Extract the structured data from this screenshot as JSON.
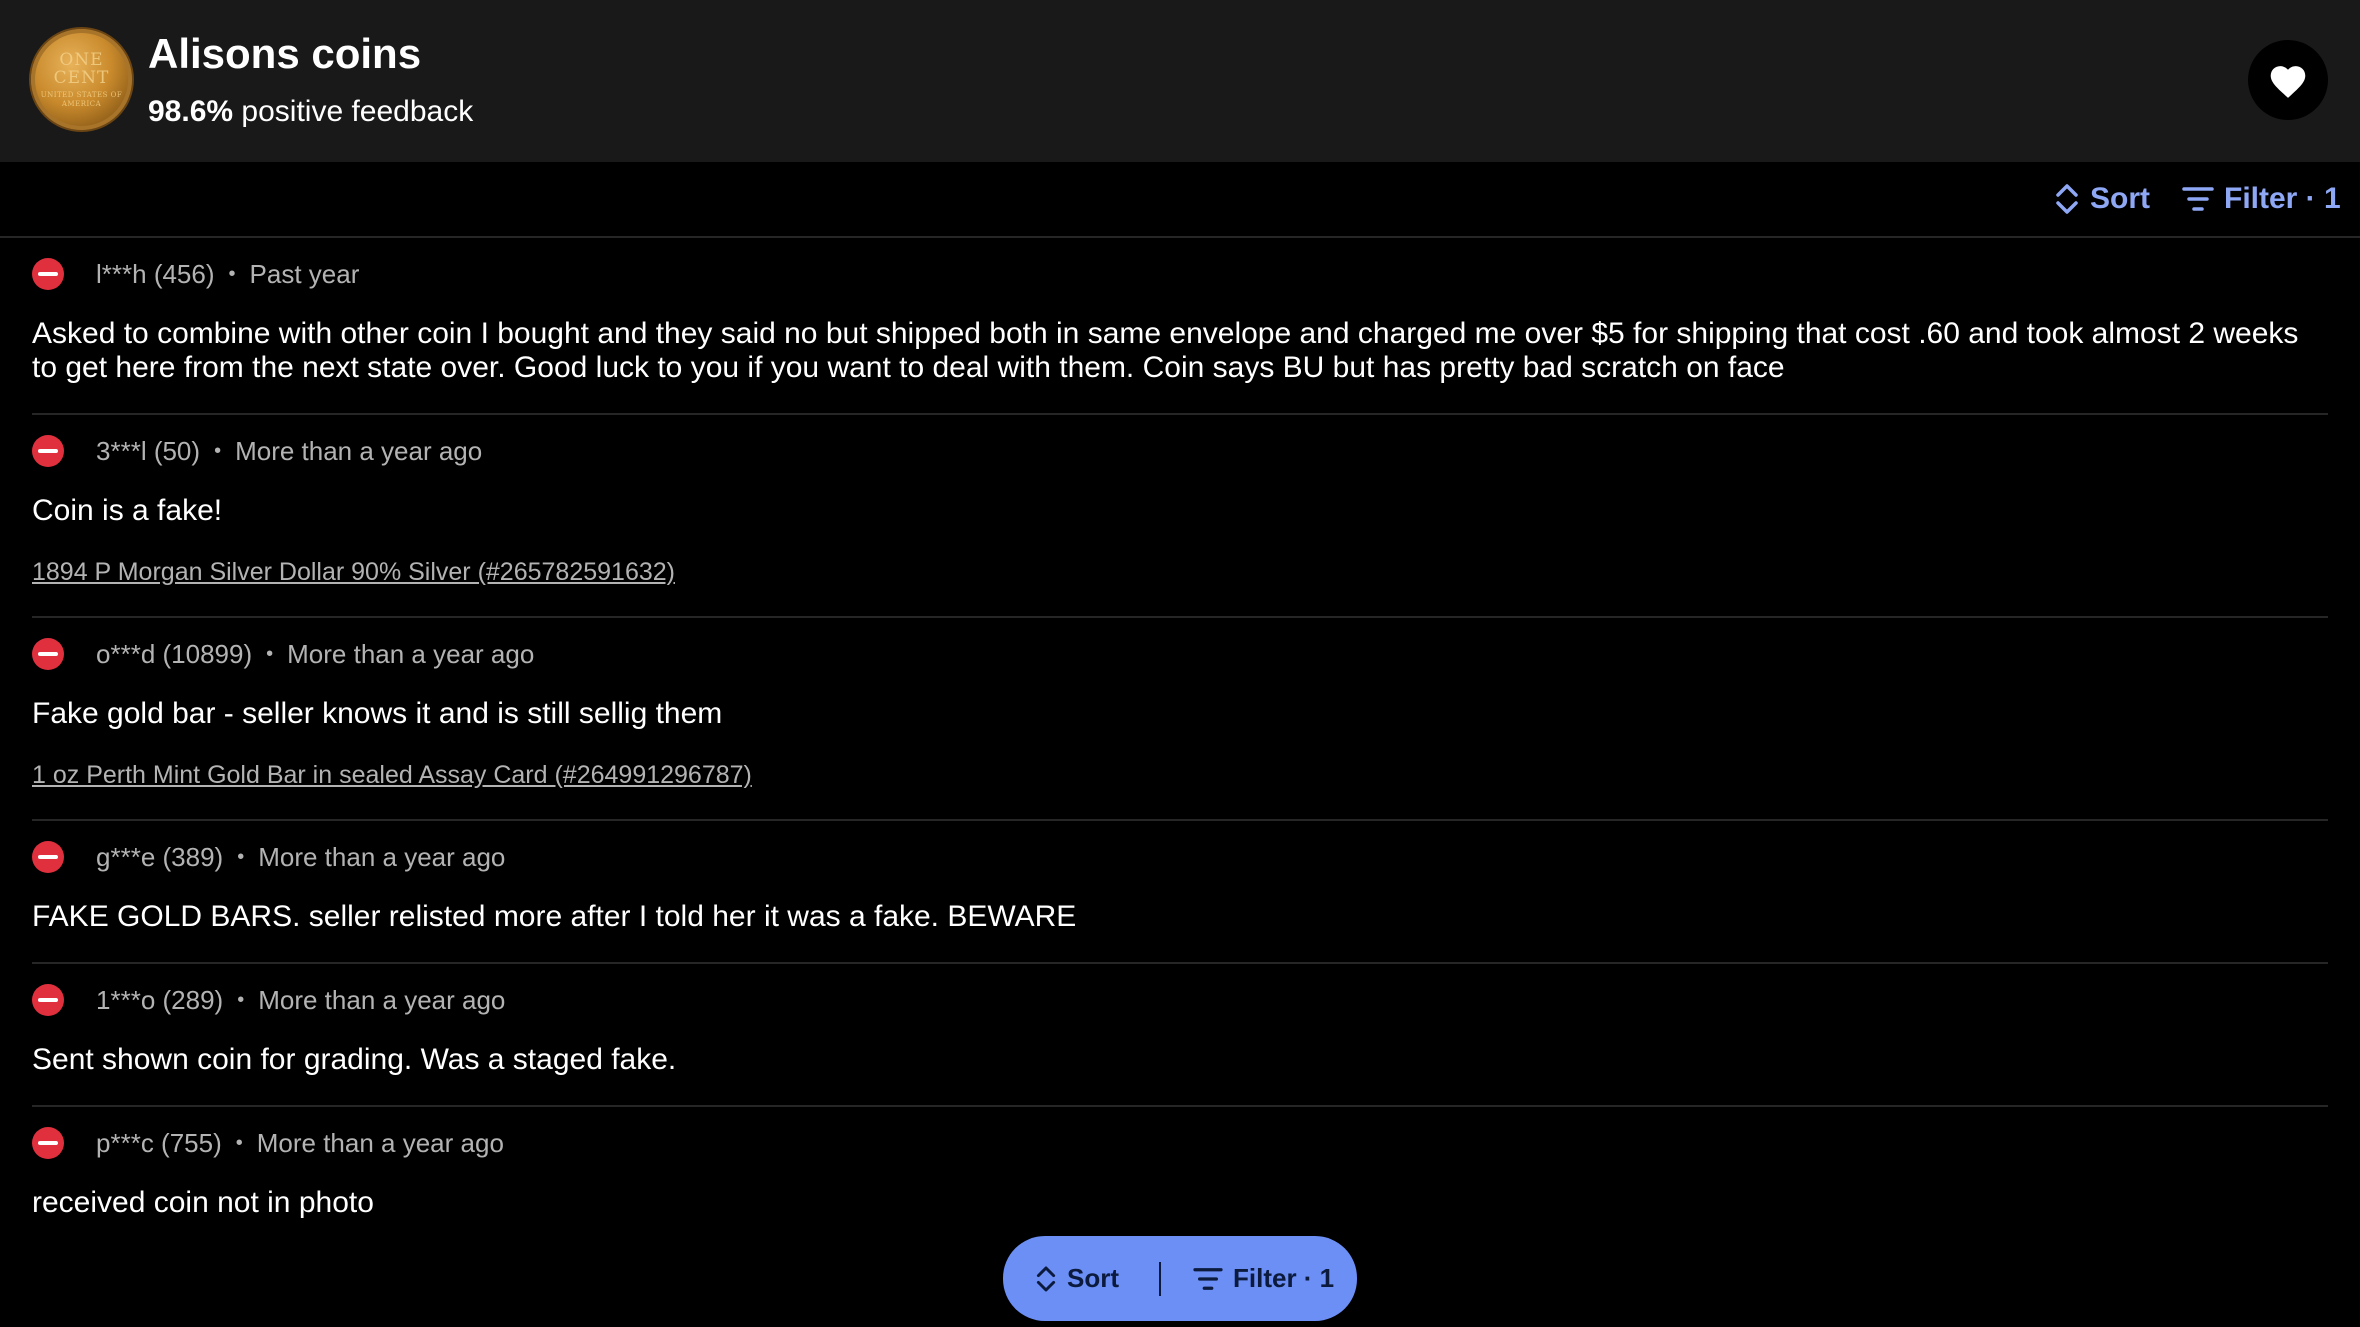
{
  "header": {
    "seller_name": "Alisons coins",
    "feedback_percent": "98.6%",
    "feedback_label": "positive feedback",
    "avatar_text_top": "ONE",
    "avatar_text_bottom": "CENT",
    "avatar_text_sub": "UNITED STATES OF AMERICA"
  },
  "toolbar": {
    "sort_label": "Sort",
    "filter_label": "Filter · 1"
  },
  "feedback": [
    {
      "user": "l***h (456)",
      "time": "Past year",
      "comment": "Asked to combine with other coin I bought and they said no but shipped both in same envelope and charged me over $5 for shipping that cost .60 and took almost 2 weeks to get here from the next state over. Good luck to you if you want to deal with them. Coin says BU but has pretty bad scratch on face",
      "item": ""
    },
    {
      "user": "3***l (50)",
      "time": "More than a year ago",
      "comment": "Coin is a fake!",
      "item": "1894 P Morgan Silver Dollar 90% Silver  (#265782591632)"
    },
    {
      "user": "o***d (10899)",
      "time": "More than a year ago",
      "comment": "Fake gold bar - seller knows it and is still sellig them",
      "item": "1 oz Perth Mint Gold Bar in sealed Assay Card (#264991296787)"
    },
    {
      "user": "g***e (389)",
      "time": "More than a year ago",
      "comment": "FAKE GOLD BARS. seller relisted more after I told her it was a fake. BEWARE",
      "item": ""
    },
    {
      "user": "1***o (289)",
      "time": "More than a year ago",
      "comment": "Sent shown coin for grading. Was a staged fake.",
      "item": ""
    },
    {
      "user": "p***c (755)",
      "time": "More than a year ago",
      "comment": "received coin not in photo",
      "item": ""
    }
  ],
  "floating_bar": {
    "sort_label": "Sort",
    "filter_label": "Filter · 1"
  },
  "colors": {
    "accent": "#8fa8f5",
    "fab_bg": "#6b8ff5",
    "negative": "#e0303e",
    "header_bg": "#191919"
  },
  "icons": {
    "avatar": "penny-coin-image",
    "heart": "heart-icon",
    "sort": "sort-chevrons-icon",
    "filter": "filter-lines-icon",
    "negative": "negative-minus-icon"
  }
}
